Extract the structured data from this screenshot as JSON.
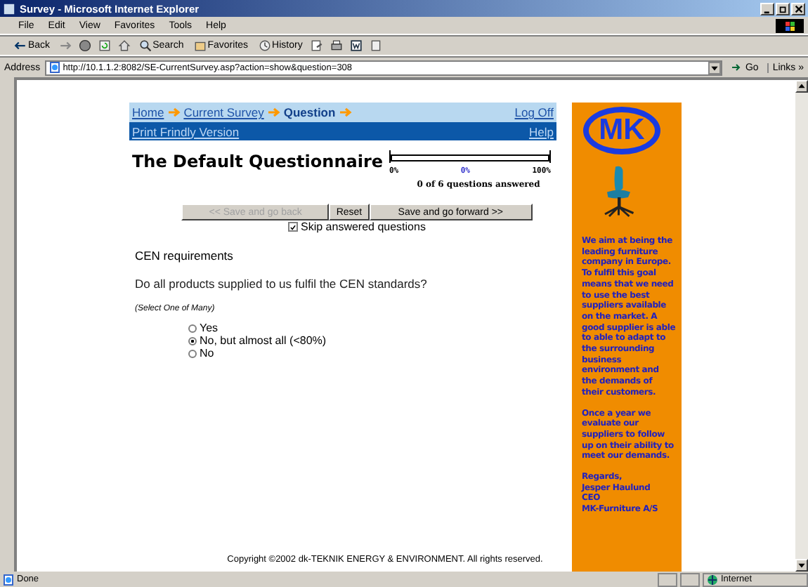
{
  "window": {
    "title": "Survey - Microsoft Internet Explorer"
  },
  "menu": [
    "File",
    "Edit",
    "View",
    "Favorites",
    "Tools",
    "Help"
  ],
  "toolbar": {
    "back": "Back",
    "search": "Search",
    "favorites": "Favorites",
    "history": "History"
  },
  "address": {
    "label": "Address",
    "value": "http://10.1.1.2:8082/SE-CurrentSurvey.asp?action=show&question=308",
    "go": "Go",
    "links": "Links »"
  },
  "breadcrumb": [
    {
      "label": "Home",
      "current": false
    },
    {
      "label": "Current Survey",
      "current": false
    },
    {
      "label": "Question",
      "current": true
    }
  ],
  "logoff": "Log Off",
  "print_link": "Print Frindly Version",
  "help_link": "Help",
  "heading": "The Default Questionnaire",
  "progress": {
    "level": 0,
    "min_label": "0%",
    "value_label": "0%",
    "max_label": "100%",
    "caption": "0 of 6 questions answered"
  },
  "buttons": [
    {
      "label": "<< Save and go back",
      "disabled": true
    },
    {
      "label": "Reset",
      "disabled": false
    },
    {
      "label": "Save and go forward >>",
      "disabled": false
    }
  ],
  "skip": {
    "label": "Skip answered questions",
    "checked": true
  },
  "section": "CEN requirements",
  "question": "Do all products supplied to us fulfil the CEN standards?",
  "hint": "(Select One of Many)",
  "options": [
    {
      "label": "Yes",
      "selected": false
    },
    {
      "label": "No, but almost all (<80%)",
      "selected": true
    },
    {
      "label": "No",
      "selected": false
    }
  ],
  "copyright": "Copyright ©2002 dk-TEKNIK ENERGY & ENVIRONMENT. All rights reserved.",
  "sidebar": {
    "logo": "MK",
    "paragraphs": [
      "We aim at being the leading furniture company in Europe. To fulfil this goal means that we need to use the best suppliers available on the market. A good supplier is able to able to adapt to the surrounding business environment and the demands of their customers.",
      "Once a year we evaluate our suppliers to follow up on their ability to meet our demands.",
      "Regards,\nJesper Haulund\nCEO\nMK-Furniture A/S"
    ]
  },
  "status_bar": {
    "text": "Done",
    "zone": "Internet"
  }
}
